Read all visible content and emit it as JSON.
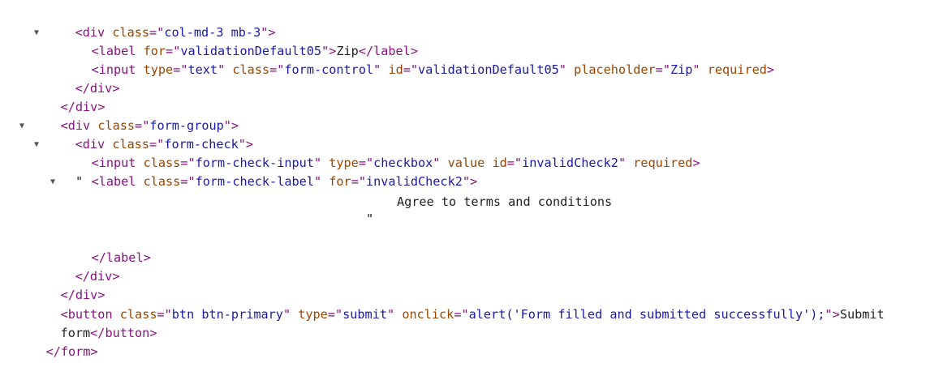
{
  "colors": {
    "tag": "#881280",
    "attr_name": "#994500",
    "attr_value": "#1a1aa6",
    "text": "#222222"
  },
  "lines": [
    {
      "kind": "open_tag",
      "expanded": true,
      "tag": "div",
      "attrs": [
        {
          "name": "class",
          "value": "col-md-3 mb-3"
        }
      ]
    },
    {
      "kind": "element_text",
      "tag": "label",
      "attrs": [
        {
          "name": "for",
          "value": "validationDefault05"
        }
      ],
      "text": "Zip"
    },
    {
      "kind": "open_tag",
      "tag": "input",
      "attrs": [
        {
          "name": "type",
          "value": "text"
        },
        {
          "name": "class",
          "value": "form-control"
        },
        {
          "name": "id",
          "value": "validationDefault05"
        },
        {
          "name": "placeholder",
          "value": "Zip"
        },
        {
          "name": "required",
          "value": null
        }
      ]
    },
    {
      "kind": "close_tag",
      "tag": "div"
    },
    {
      "kind": "close_tag",
      "tag": "div"
    },
    {
      "kind": "open_tag",
      "expanded": true,
      "tag": "div",
      "attrs": [
        {
          "name": "class",
          "value": "form-group"
        }
      ]
    },
    {
      "kind": "open_tag",
      "expanded": true,
      "tag": "div",
      "attrs": [
        {
          "name": "class",
          "value": "form-check"
        }
      ]
    },
    {
      "kind": "open_tag",
      "tag": "input",
      "attrs": [
        {
          "name": "class",
          "value": "form-check-input"
        },
        {
          "name": "type",
          "value": "checkbox"
        },
        {
          "name": "value",
          "value": null
        },
        {
          "name": "id",
          "value": "invalidCheck2"
        },
        {
          "name": "required",
          "value": null
        }
      ]
    },
    {
      "kind": "open_tag",
      "expanded": true,
      "tag": "label",
      "attrs": [
        {
          "name": "class",
          "value": "form-check-label"
        },
        {
          "name": "for",
          "value": "invalidCheck2"
        }
      ]
    },
    {
      "kind": "text",
      "text": "\""
    },
    {
      "kind": "text",
      "text": "Agree to terms and conditions"
    },
    {
      "kind": "text",
      "text": "\""
    },
    {
      "kind": "close_tag",
      "tag": "label"
    },
    {
      "kind": "close_tag",
      "tag": "div"
    },
    {
      "kind": "close_tag",
      "tag": "div"
    },
    {
      "kind": "open_tag_text",
      "tag": "button",
      "attrs": [
        {
          "name": "class",
          "value": "btn btn-primary"
        },
        {
          "name": "type",
          "value": "submit"
        },
        {
          "name": "onclick",
          "value": "alert('Form filled and submitted successfully');"
        }
      ],
      "text": "Submit"
    },
    {
      "kind": "text_close",
      "tag": "button",
      "text": "form"
    },
    {
      "kind": "close_tag",
      "tag": "form"
    }
  ]
}
